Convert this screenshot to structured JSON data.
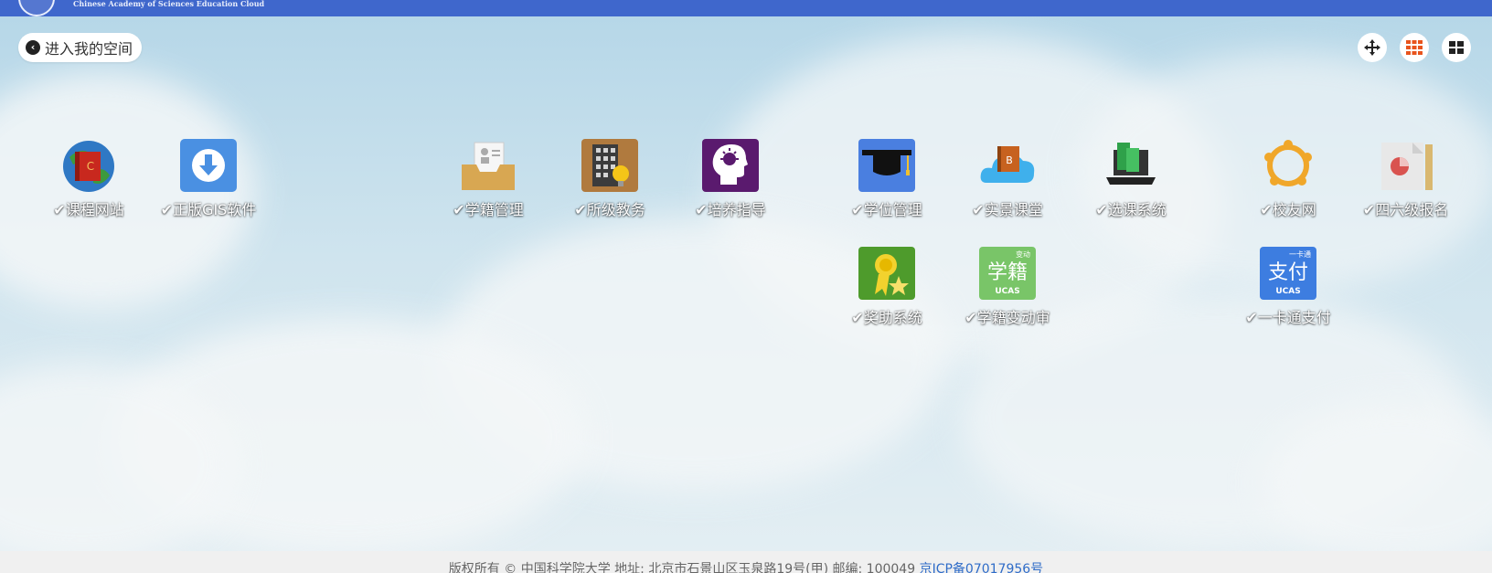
{
  "header": {
    "subtitle": "Chinese Academy of Sciences Education Cloud"
  },
  "nav": {
    "back_label": "进入我的空间"
  },
  "toolbar": {
    "icons": [
      "move-icon",
      "grid-small-icon",
      "grid-large-icon"
    ],
    "accent": "#e8541d"
  },
  "apps": {
    "a1": {
      "label": "课程网站"
    },
    "a2": {
      "label": "正版GIS软件"
    },
    "a3": {
      "label": "学籍管理"
    },
    "a4": {
      "label": "所级教务"
    },
    "a5": {
      "label": "培养指导"
    },
    "a6": {
      "label": "学位管理"
    },
    "a7": {
      "label": "实景课堂"
    },
    "a8": {
      "label": "选课系统"
    },
    "a9": {
      "label": "校友网"
    },
    "a10": {
      "label": "四六级报名"
    },
    "a11": {
      "label": "奖助系统"
    },
    "a12": {
      "label": "学籍变动审"
    },
    "a13": {
      "label": "一卡通支付"
    },
    "a12_icon": {
      "big": "学籍",
      "small": "变动",
      "sub": "UCAS"
    },
    "a13_icon": {
      "big": "支付",
      "small": "一卡通",
      "sub": "UCAS"
    }
  },
  "footer": {
    "text": "版权所有 © 中国科学院大学 地址: 北京市石景山区玉泉路19号(甲) 邮编: 100049",
    "icp": "京ICP备07017956号"
  }
}
